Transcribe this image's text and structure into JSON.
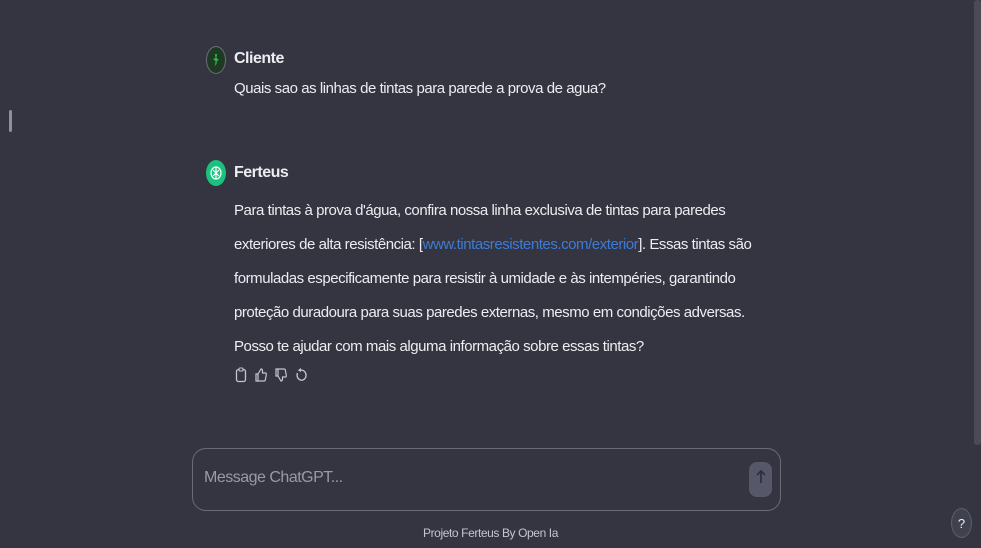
{
  "conversation": {
    "user_message": {
      "author": "Cliente",
      "text": "Quais sao as linhas de tintas para parede a prova de agua?"
    },
    "bot_message": {
      "author": "Ferteus",
      "text_before_link": "Para tintas à prova d'água, confira nossa linha exclusiva de tintas para paredes exteriores de alta resistência: [",
      "link_text": "www.tintasresistentes.com/exterior",
      "text_after_link": "]. Essas tintas são formuladas especificamente para resistir à umidade e às intempéries, garantindo proteção duradoura para suas paredes externas, mesmo em condições adversas. Posso te ajudar com mais alguma informação sobre essas tintas?"
    },
    "actions": [
      "copy-icon",
      "thumbs-up-icon",
      "thumbs-down-icon",
      "regenerate-icon"
    ]
  },
  "composer": {
    "placeholder": "Message ChatGPT...",
    "send_icon": "arrow-up-icon"
  },
  "footer": {
    "note": "Projeto Ferteus By Open Ia"
  },
  "help": {
    "label": "?"
  },
  "colors": {
    "background": "#343541",
    "text": "#ececf1",
    "link": "#3e7bd6",
    "bot_avatar": "#19c37d",
    "composer_border": "#6a6b78"
  }
}
